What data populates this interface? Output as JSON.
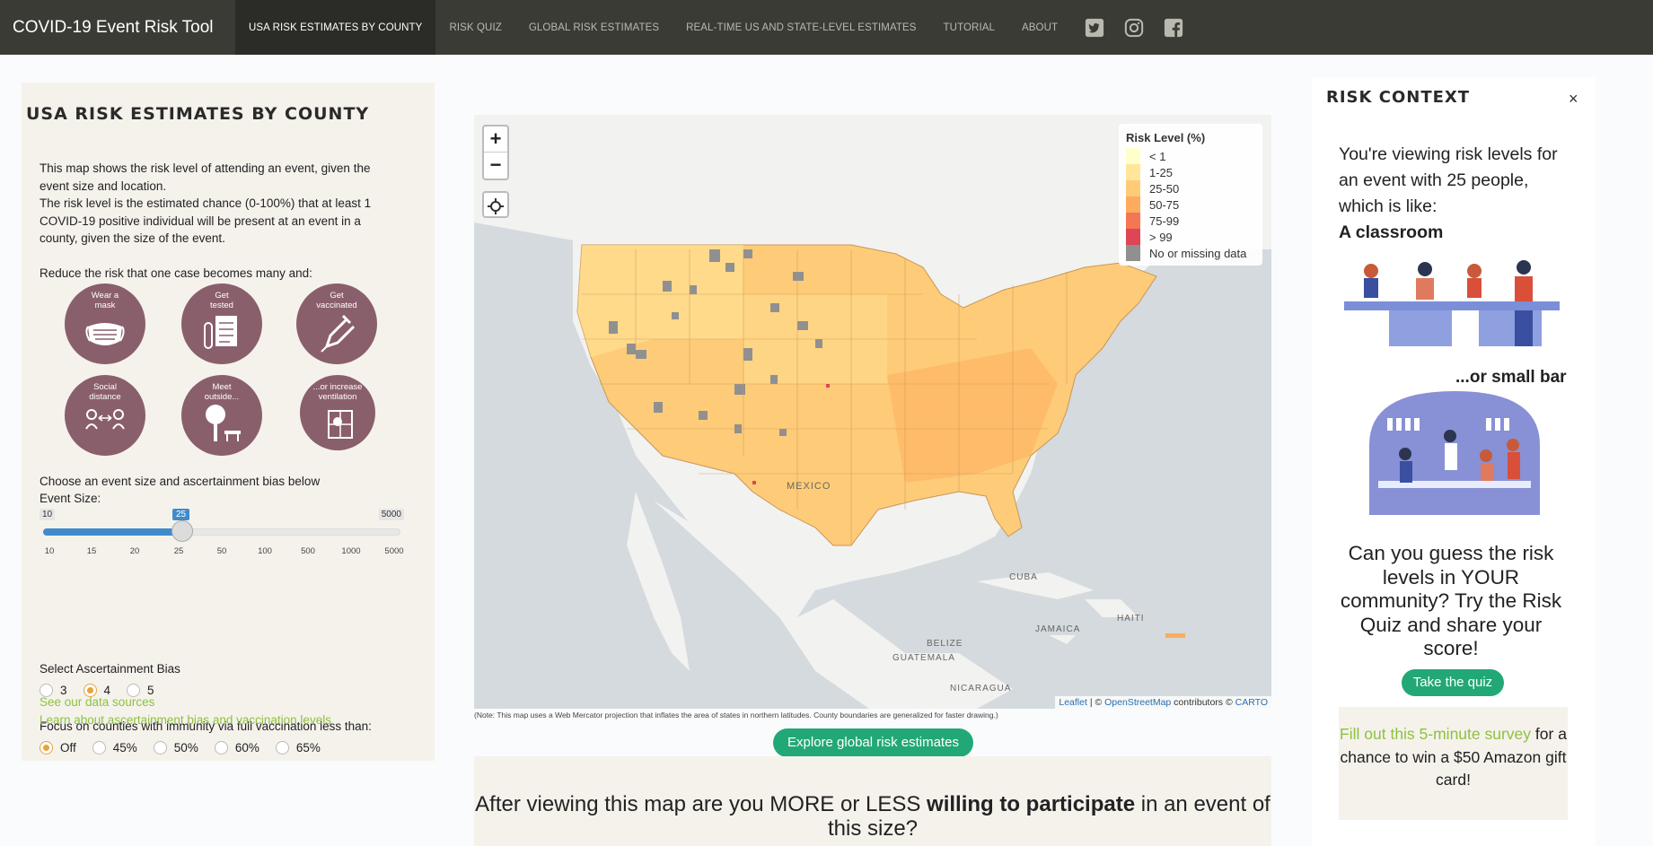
{
  "nav": {
    "brand": "COVID-19 Event Risk Tool",
    "items": [
      {
        "label": "USA RISK ESTIMATES BY COUNTY",
        "active": true
      },
      {
        "label": "RISK QUIZ"
      },
      {
        "label": "GLOBAL RISK ESTIMATES"
      },
      {
        "label": "REAL-TIME US AND STATE-LEVEL ESTIMATES"
      },
      {
        "label": "TUTORIAL"
      },
      {
        "label": "ABOUT"
      }
    ],
    "social_icons": [
      "twitter-icon",
      "instagram-icon",
      "facebook-icon"
    ]
  },
  "left": {
    "title": "USA RISK ESTIMATES BY COUNTY",
    "intro_1": "This map shows the risk level of attending an event, given the event size and location.",
    "intro_2": "The risk level is the estimated chance (0-100%) that at least 1 COVID-19 positive individual will be present at an event in a county, given the size of the event.",
    "reduce": "Reduce the risk that one case becomes many and:",
    "tips": [
      {
        "label": "Wear a mask",
        "icon": "mask-icon"
      },
      {
        "label": "Get tested",
        "icon": "test-icon"
      },
      {
        "label": "Get vaccinated",
        "icon": "syringe-icon"
      },
      {
        "label": "Social distance",
        "icon": "distance-icon"
      },
      {
        "label": "Meet outside...",
        "icon": "tree-icon"
      },
      {
        "label": "...or increase ventilation",
        "icon": "window-icon"
      }
    ],
    "choose": "Choose an event size and ascertainment bias below",
    "event_size_label": "Event Size:",
    "slider": {
      "min": "10",
      "max": "5000",
      "value": "25",
      "ticks": [
        "10",
        "15",
        "20",
        "25",
        "50",
        "100",
        "500",
        "1000",
        "5000"
      ]
    },
    "bias_label": "Select Ascertainment Bias",
    "bias_options": [
      "3",
      "4",
      "5"
    ],
    "bias_selected": "4",
    "vacc_label": "Focus on counties with immunity via full vaccination less than:",
    "vacc_options": [
      "Off",
      "45%",
      "50%",
      "60%",
      "65%"
    ],
    "vacc_selected": "Off",
    "link_sources": "See our data sources",
    "link_learn": "Learn about ascertainment bias and vaccination levels"
  },
  "map": {
    "zoom_in": "+",
    "zoom_out": "−",
    "legend_title": "Risk Level (%)",
    "legend": [
      {
        "label": "< 1",
        "color": "#ffffcc"
      },
      {
        "label": "1-25",
        "color": "#ffe69a"
      },
      {
        "label": "25-50",
        "color": "#fecc78"
      },
      {
        "label": "50-75",
        "color": "#fdac5e"
      },
      {
        "label": "75-99",
        "color": "#f57653"
      },
      {
        "label": "> 99",
        "color": "#e04555"
      },
      {
        "label": "No or missing data",
        "color": "#909090"
      }
    ],
    "labels": {
      "mexico": "MEXICO",
      "cuba": "CUBA",
      "jamaica": "JAMAICA",
      "haiti": "HAITI",
      "belize": "BELIZE",
      "guatemala": "GUATEMALA",
      "nicaragua": "NICARAGUA"
    },
    "attr_leaflet": "Leaflet",
    "attr_mid": " | © ",
    "attr_osm": "OpenStreetMap",
    "attr_contrib": " contributors © ",
    "attr_carto": "CARTO",
    "note": "(Note: This map uses a Web Mercator projection that inflates the area of states in northern latitudes. County boundaries are generalized for faster drawing.)"
  },
  "explore_button": "Explore global risk estimates",
  "willing": {
    "pre": "After viewing this map are you MORE or LESS ",
    "bold": "willing to participate",
    "post": " in an event of this size?"
  },
  "right": {
    "title": "RISK CONTEXT",
    "close": "×",
    "viewing": "You're viewing risk levels for an event with 25 people, which is like:",
    "example_1": "A classroom",
    "example_2": "...or small bar",
    "guess": "Can you guess the risk levels in YOUR community? Try the Risk Quiz and share your score!",
    "quiz_button": "Take the quiz",
    "survey_link": "Fill out this 5-minute survey",
    "survey_rest": " for a chance to win a $50 Amazon gift card!"
  }
}
